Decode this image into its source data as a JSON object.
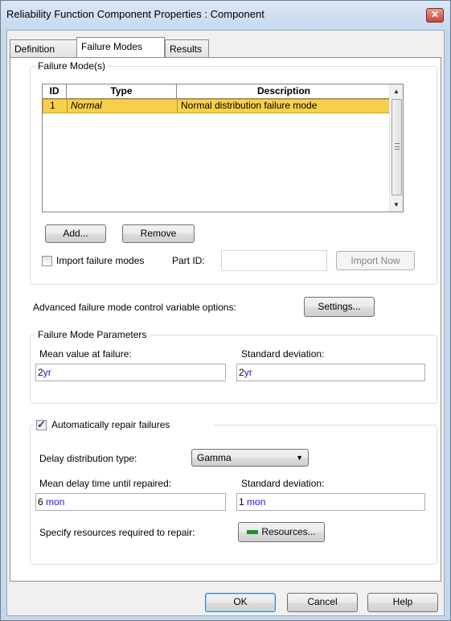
{
  "window": {
    "title": "Reliability Function Component Properties : Component",
    "close_glyph": "✕"
  },
  "tabs": [
    {
      "label": "Definition",
      "active": false
    },
    {
      "label": "Failure Modes",
      "active": true
    },
    {
      "label": "Results",
      "active": false
    }
  ],
  "failure_modes": {
    "group_label": "Failure Mode(s)",
    "columns": [
      "ID",
      "Type",
      "Description"
    ],
    "rows": [
      {
        "id": "1",
        "type": "Normal",
        "description": "Normal distribution failure mode",
        "selected": true
      }
    ],
    "add_label": "Add...",
    "remove_label": "Remove",
    "import_checkbox_label": "Import failure modes",
    "import_checked": false,
    "part_id_label": "Part ID:",
    "part_id_value": "",
    "import_now_label": "Import Now"
  },
  "advanced": {
    "label": "Advanced failure mode control variable options:",
    "settings_label": "Settings..."
  },
  "parameters": {
    "group_label": "Failure Mode Parameters",
    "mean_label": "Mean value at failure:",
    "mean_value": "2",
    "mean_unit": "yr",
    "sd_label": "Standard deviation:",
    "sd_value": "2",
    "sd_unit": "yr"
  },
  "repair": {
    "auto_label": "Automatically repair failures",
    "auto_checked": true,
    "delay_type_label": "Delay distribution type:",
    "delay_type_value": "Gamma",
    "mean_delay_label": "Mean delay time until repaired:",
    "mean_delay_value": "6",
    "mean_delay_unit": "mon",
    "sd_label": "Standard deviation:",
    "sd_value": "1",
    "sd_unit": "mon",
    "resources_prompt": "Specify resources required to repair:",
    "resources_label": "Resources..."
  },
  "footer": {
    "ok_label": "OK",
    "cancel_label": "Cancel",
    "help_label": "Help"
  },
  "colors": {
    "selection": "#f8d04a",
    "unit_text": "#1a1ad6",
    "title_bar": "#c7d9ee"
  }
}
